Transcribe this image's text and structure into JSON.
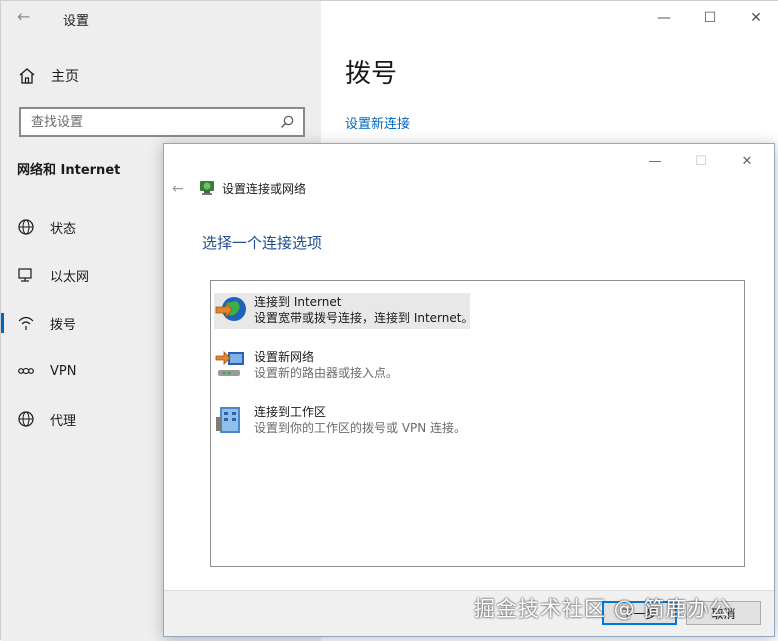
{
  "window": {
    "title": "设置",
    "controls": {
      "minimize": "—",
      "maximize": "☐",
      "close": "✕"
    }
  },
  "sidebar": {
    "back": "←",
    "home_label": "主页",
    "search_placeholder": "查找设置",
    "section_title": "网络和 Internet",
    "items": [
      {
        "label": "状态",
        "icon": "globe-icon"
      },
      {
        "label": "以太网",
        "icon": "ethernet-icon"
      },
      {
        "label": "拨号",
        "icon": "dialup-icon",
        "selected": true
      },
      {
        "label": "VPN",
        "icon": "vpn-icon"
      },
      {
        "label": "代理",
        "icon": "globe-icon"
      }
    ]
  },
  "main": {
    "title": "拨号",
    "link": "设置新连接"
  },
  "dialog": {
    "back": "←",
    "title": "设置连接或网络",
    "heading": "选择一个连接选项",
    "controls": {
      "minimize": "—",
      "maximize": "☐",
      "close": "✕"
    },
    "options": [
      {
        "title": "连接到 Internet",
        "desc": "设置宽带或拨号连接，连接到 Internet。",
        "icon": "globe-connect-icon",
        "selected": true
      },
      {
        "title": "设置新网络",
        "desc": "设置新的路由器或接入点。",
        "icon": "new-network-icon"
      },
      {
        "title": "连接到工作区",
        "desc": "设置到你的工作区的拨号或 VPN 连接。",
        "icon": "workplace-icon"
      }
    ],
    "buttons": {
      "next": "下一步",
      "cancel": "取消"
    }
  },
  "watermark": "掘金技术社区 @ 简鹿办公",
  "colors": {
    "accent": "#0067c0",
    "sidebar_bg": "#eeeeee",
    "dialog_heading": "#1f4f8f"
  }
}
